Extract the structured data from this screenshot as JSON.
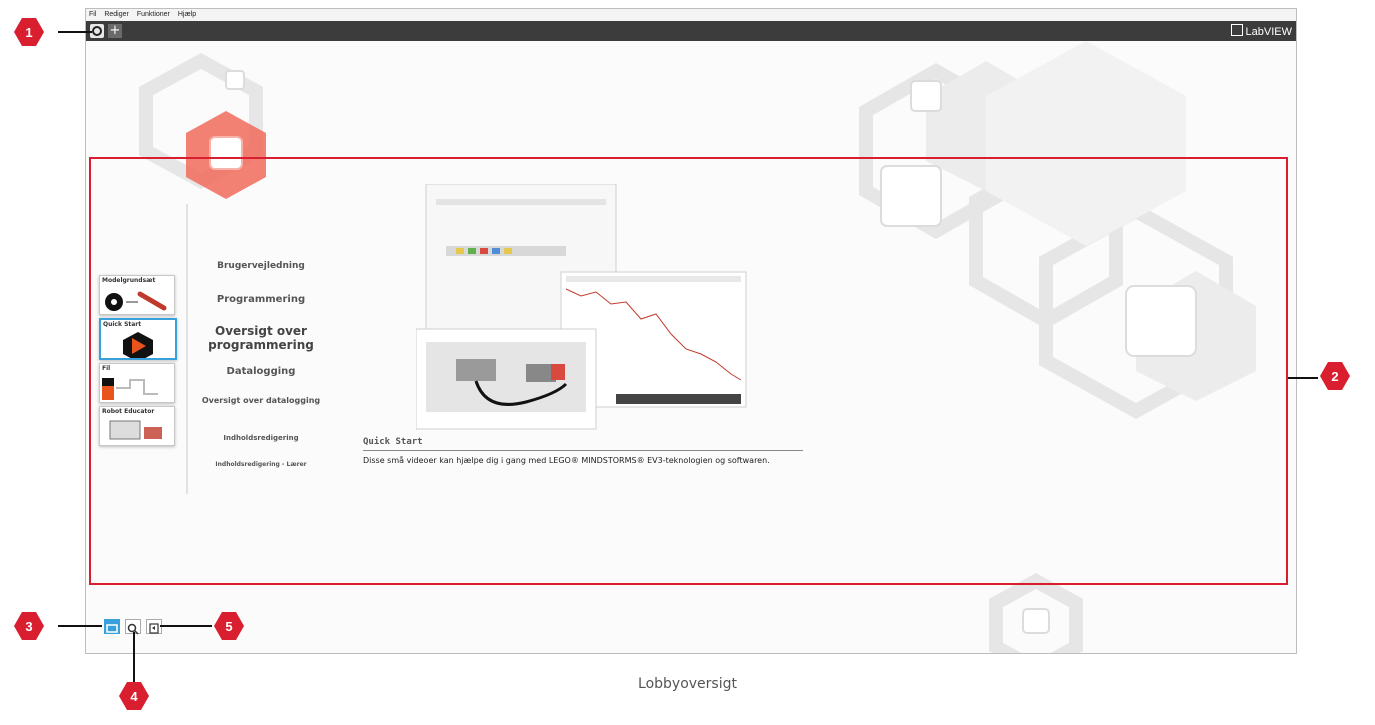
{
  "menubar": {
    "items": [
      "Fil",
      "Rediger",
      "Funktioner",
      "Hjælp"
    ]
  },
  "tabbar": {
    "add_label": "+",
    "brand": "LabVIEW"
  },
  "sidebar": {
    "cards": [
      {
        "label": "Modelgrundsæt",
        "icon": "gear-icon"
      },
      {
        "label": "Quick Start",
        "icon": "play-icon"
      },
      {
        "label": "Fil",
        "icon": "file-icon"
      },
      {
        "label": "Robot Educator",
        "icon": "robot-icon"
      }
    ]
  },
  "nav": {
    "items": [
      "Brugervejledning",
      "Programmering",
      "Oversigt over programmering",
      "Datalogging",
      "Oversigt over datalogging",
      "Indholdsredigering",
      "Indholdsredigering - Lærer"
    ]
  },
  "content": {
    "title": "Quick Start",
    "description": "Disse små videoer kan hjælpe dig i gang med LEGO® MINDSTORMS® EV3-teknologien og softwaren."
  },
  "bottom_toolbar": {
    "icons": [
      "lobby-icon",
      "search-icon",
      "exit-icon"
    ]
  },
  "callouts": [
    "1",
    "2",
    "3",
    "4",
    "5"
  ],
  "caption": "Lobbyoversigt",
  "colors": {
    "callout_red": "#d91f2f",
    "active_blue": "#3aa0dc",
    "tabbar": "#3c3c3c"
  }
}
